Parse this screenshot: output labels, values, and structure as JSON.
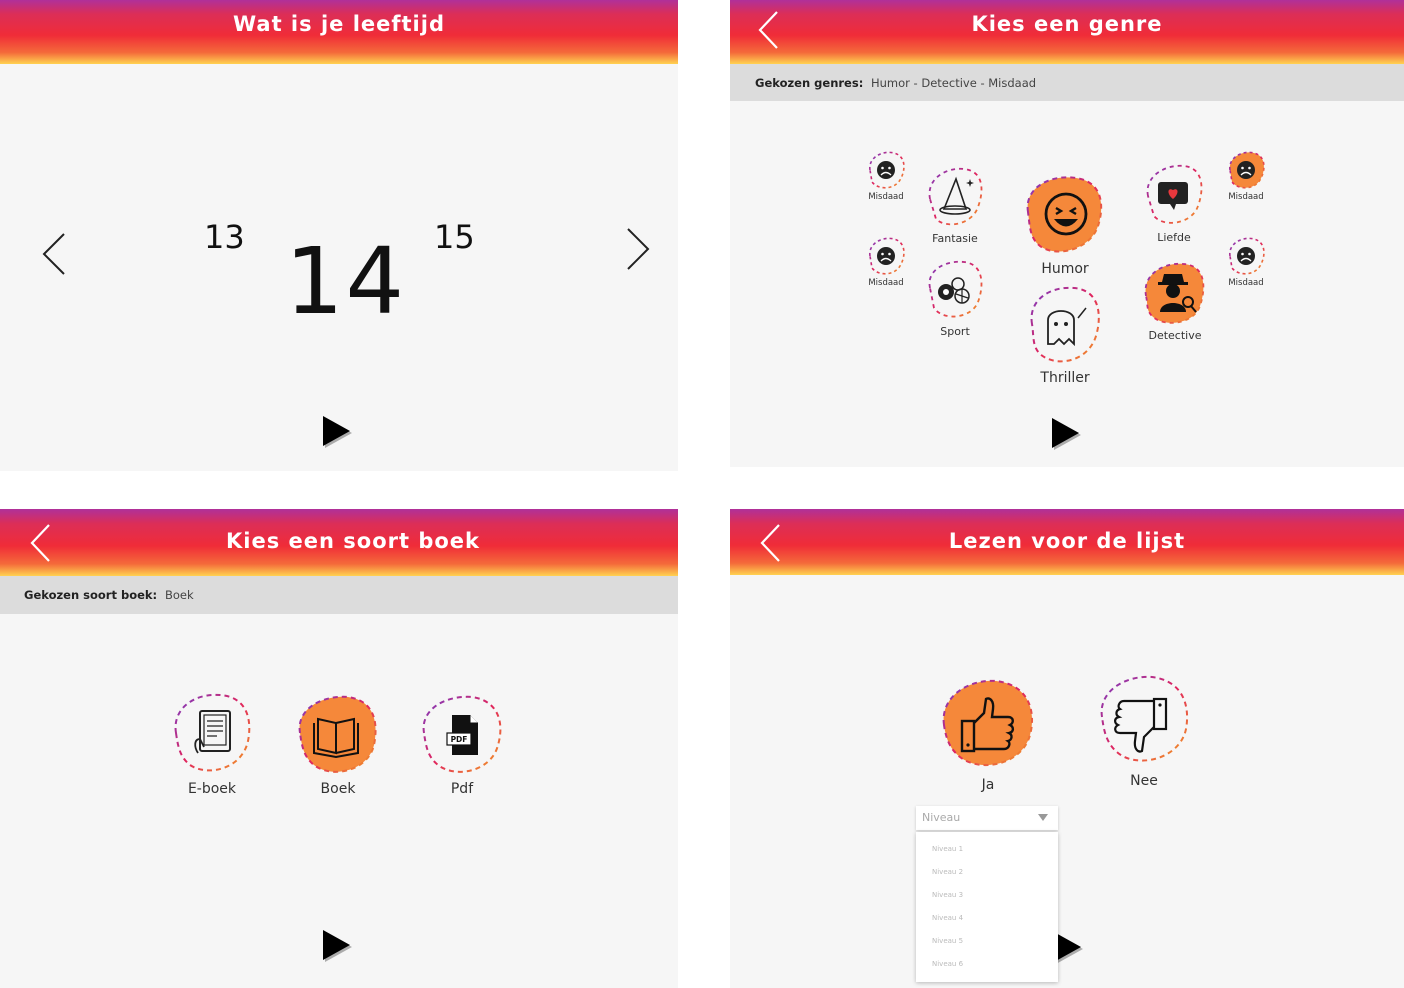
{
  "age_screen": {
    "title": "Wat is je leeftijd",
    "prev_value": "13",
    "current_value": "14",
    "next_value": "15",
    "icons": {
      "prev": "chevron-left-icon",
      "next": "chevron-right-icon",
      "play": "play-icon"
    }
  },
  "genre_screen": {
    "title": "Kies een genre",
    "chosen_label": "Gekozen genres:",
    "chosen_value": "Humor - Detective - Misdaad",
    "genres": {
      "misdaad_1": "Misdaad",
      "misdaad_2": "Misdaad",
      "fantasie": "Fantasie",
      "sport": "Sport",
      "humor": "Humor",
      "thriller": "Thriller",
      "liefde": "Liefde",
      "detective": "Detective",
      "misdaad_3": "Misdaad",
      "misdaad_4": "Misdaad"
    },
    "selected_color": "#f5883a"
  },
  "booktype_screen": {
    "title": "Kies een soort boek",
    "chosen_label": "Gekozen soort boek:",
    "chosen_value": "Boek",
    "options": {
      "ebook": "E-boek",
      "boek": "Boek",
      "pdf": "Pdf"
    },
    "pdf_badge": "PDF"
  },
  "list_screen": {
    "title": "Lezen voor de lijst",
    "yes_label": "Ja",
    "no_label": "Nee",
    "select": {
      "placeholder": "Niveau",
      "options": [
        "Niveau 1",
        "Niveau 2",
        "Niveau 3",
        "Niveau 4",
        "Niveau 5",
        "Niveau 6"
      ]
    }
  },
  "colors": {
    "accent": "#f5883a",
    "gradient": [
      "#b0309a",
      "#f02c38",
      "#ffd251"
    ],
    "dash": [
      "#7a3cc4",
      "#e0245e",
      "#f4a020"
    ]
  }
}
